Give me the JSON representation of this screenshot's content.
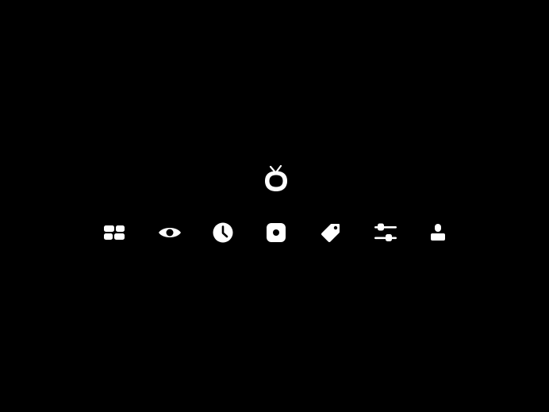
{
  "app": {
    "logo_icon": "tv-icon",
    "background_color": "#000000",
    "icon_color": "#ffffff"
  },
  "navigation": {
    "items": [
      {
        "id": "board",
        "icon": "grid-icon"
      },
      {
        "id": "discover",
        "icon": "eye-icon"
      },
      {
        "id": "history",
        "icon": "clock-icon"
      },
      {
        "id": "library",
        "icon": "disc-icon"
      },
      {
        "id": "addons",
        "icon": "tag-icon"
      },
      {
        "id": "settings",
        "icon": "sliders-icon"
      },
      {
        "id": "profile",
        "icon": "user-icon"
      }
    ]
  }
}
